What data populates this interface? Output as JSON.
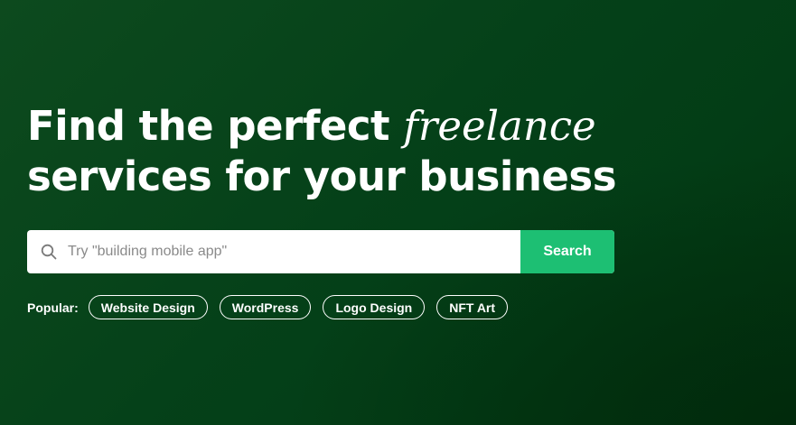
{
  "hero": {
    "headline_line1": "Find the perfect ",
    "headline_accent": "freelance",
    "headline_line2": "services for your business"
  },
  "search": {
    "placeholder": "Try \"building mobile app\"",
    "button_label": "Search",
    "icon": "search-icon"
  },
  "popular": {
    "label": "Popular:",
    "tags": [
      {
        "label": "Website Design"
      },
      {
        "label": "WordPress"
      },
      {
        "label": "Logo Design"
      },
      {
        "label": "NFT Art"
      }
    ]
  },
  "colors": {
    "background": "#054119",
    "accent": "#1dbf73",
    "text": "#ffffff"
  }
}
